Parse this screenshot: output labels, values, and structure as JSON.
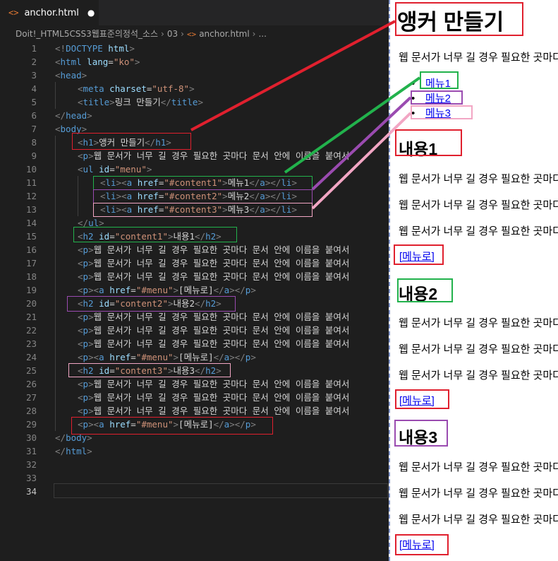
{
  "editor": {
    "tab": {
      "name": "anchor.html",
      "modified_dot": "●"
    },
    "breadcrumb": {
      "folder": "Doit!_HTML5CSS3웹표준의정석_소스",
      "subfolder": "03",
      "file": "anchor.html",
      "more": "..."
    },
    "active_line": 34,
    "lines": [
      {
        "n": "1",
        "ind": 0,
        "tok": [
          [
            "p",
            "<!"
          ],
          [
            "t",
            "DOCTYPE"
          ],
          [
            "x",
            " "
          ],
          [
            "a",
            "html"
          ],
          [
            "p",
            ">"
          ]
        ]
      },
      {
        "n": "2",
        "ind": 0,
        "tok": [
          [
            "p",
            "<"
          ],
          [
            "t",
            "html"
          ],
          [
            "x",
            " "
          ],
          [
            "a",
            "lang"
          ],
          [
            "x",
            "="
          ],
          [
            "s",
            "\"ko\""
          ],
          [
            "p",
            ">"
          ]
        ]
      },
      {
        "n": "3",
        "ind": 0,
        "tok": [
          [
            "p",
            "<"
          ],
          [
            "t",
            "head"
          ],
          [
            "p",
            ">"
          ]
        ]
      },
      {
        "n": "4",
        "ind": 1,
        "tok": [
          [
            "p",
            "<"
          ],
          [
            "t",
            "meta"
          ],
          [
            "x",
            " "
          ],
          [
            "a",
            "charset"
          ],
          [
            "x",
            "="
          ],
          [
            "s",
            "\"utf-8\""
          ],
          [
            "p",
            ">"
          ]
        ]
      },
      {
        "n": "5",
        "ind": 1,
        "tok": [
          [
            "p",
            "<"
          ],
          [
            "t",
            "title"
          ],
          [
            "p",
            ">"
          ],
          [
            "x",
            "링크 만들기"
          ],
          [
            "p",
            "</"
          ],
          [
            "t",
            "title"
          ],
          [
            "p",
            ">"
          ]
        ]
      },
      {
        "n": "6",
        "ind": 0,
        "tok": [
          [
            "p",
            "</"
          ],
          [
            "t",
            "head"
          ],
          [
            "p",
            ">"
          ]
        ]
      },
      {
        "n": "7",
        "ind": 0,
        "tok": [
          [
            "p",
            "<"
          ],
          [
            "t",
            "body"
          ],
          [
            "p",
            ">"
          ]
        ]
      },
      {
        "n": "8",
        "ind": 1,
        "tok": [
          [
            "p",
            "<"
          ],
          [
            "t",
            "h1"
          ],
          [
            "p",
            ">"
          ],
          [
            "x",
            "앵커 만들기"
          ],
          [
            "p",
            "</"
          ],
          [
            "t",
            "h1"
          ],
          [
            "p",
            ">"
          ]
        ]
      },
      {
        "n": "9",
        "ind": 1,
        "tok": [
          [
            "p",
            "<"
          ],
          [
            "t",
            "p"
          ],
          [
            "p",
            ">"
          ],
          [
            "x",
            "웹 문서가 너무 길 경우 필요한 곳마다 문서 안에 이름을 붙여서"
          ]
        ]
      },
      {
        "n": "10",
        "ind": 1,
        "tok": [
          [
            "p",
            "<"
          ],
          [
            "t",
            "ul"
          ],
          [
            "x",
            " "
          ],
          [
            "a",
            "id"
          ],
          [
            "x",
            "="
          ],
          [
            "s",
            "\"menu\""
          ],
          [
            "p",
            ">"
          ]
        ]
      },
      {
        "n": "11",
        "ind": 2,
        "tok": [
          [
            "p",
            "<"
          ],
          [
            "t",
            "li"
          ],
          [
            "p",
            "><"
          ],
          [
            "t",
            "a"
          ],
          [
            "x",
            " "
          ],
          [
            "a",
            "href"
          ],
          [
            "x",
            "="
          ],
          [
            "s",
            "\"#content1\""
          ],
          [
            "p",
            ">"
          ],
          [
            "x",
            "메뉴1"
          ],
          [
            "p",
            "</"
          ],
          [
            "t",
            "a"
          ],
          [
            "p",
            "></"
          ],
          [
            "t",
            "li"
          ],
          [
            "p",
            ">"
          ]
        ]
      },
      {
        "n": "12",
        "ind": 2,
        "tok": [
          [
            "p",
            "<"
          ],
          [
            "t",
            "li"
          ],
          [
            "p",
            "><"
          ],
          [
            "t",
            "a"
          ],
          [
            "x",
            " "
          ],
          [
            "a",
            "href"
          ],
          [
            "x",
            "="
          ],
          [
            "s",
            "\"#content2\""
          ],
          [
            "p",
            ">"
          ],
          [
            "x",
            "메뉴2"
          ],
          [
            "p",
            "</"
          ],
          [
            "t",
            "a"
          ],
          [
            "p",
            "></"
          ],
          [
            "t",
            "li"
          ],
          [
            "p",
            ">"
          ]
        ]
      },
      {
        "n": "13",
        "ind": 2,
        "tok": [
          [
            "p",
            "<"
          ],
          [
            "t",
            "li"
          ],
          [
            "p",
            "><"
          ],
          [
            "t",
            "a"
          ],
          [
            "x",
            " "
          ],
          [
            "a",
            "href"
          ],
          [
            "x",
            "="
          ],
          [
            "s",
            "\"#content3\""
          ],
          [
            "p",
            ">"
          ],
          [
            "x",
            "메뉴3"
          ],
          [
            "p",
            "</"
          ],
          [
            "t",
            "a"
          ],
          [
            "p",
            "></"
          ],
          [
            "t",
            "li"
          ],
          [
            "p",
            ">"
          ]
        ]
      },
      {
        "n": "14",
        "ind": 1,
        "tok": [
          [
            "p",
            "</"
          ],
          [
            "t",
            "ul"
          ],
          [
            "p",
            ">"
          ]
        ]
      },
      {
        "n": "15",
        "ind": 1,
        "tok": [
          [
            "p",
            "<"
          ],
          [
            "t",
            "h2"
          ],
          [
            "x",
            " "
          ],
          [
            "a",
            "id"
          ],
          [
            "x",
            "="
          ],
          [
            "s",
            "\"content1\""
          ],
          [
            "p",
            ">"
          ],
          [
            "x",
            "내용1"
          ],
          [
            "p",
            "</"
          ],
          [
            "t",
            "h2"
          ],
          [
            "p",
            ">"
          ]
        ]
      },
      {
        "n": "16",
        "ind": 1,
        "tok": [
          [
            "p",
            "<"
          ],
          [
            "t",
            "p"
          ],
          [
            "p",
            ">"
          ],
          [
            "x",
            "웹 문서가 너무 길 경우 필요한 곳마다 문서 안에 이름을 붙여서"
          ]
        ]
      },
      {
        "n": "17",
        "ind": 1,
        "tok": [
          [
            "p",
            "<"
          ],
          [
            "t",
            "p"
          ],
          [
            "p",
            ">"
          ],
          [
            "x",
            "웹 문서가 너무 길 경우 필요한 곳마다 문서 안에 이름을 붙여서"
          ]
        ]
      },
      {
        "n": "18",
        "ind": 1,
        "tok": [
          [
            "p",
            "<"
          ],
          [
            "t",
            "p"
          ],
          [
            "p",
            ">"
          ],
          [
            "x",
            "웹 문서가 너무 길 경우 필요한 곳마다 문서 안에 이름을 붙여서"
          ]
        ]
      },
      {
        "n": "19",
        "ind": 1,
        "tok": [
          [
            "p",
            "<"
          ],
          [
            "t",
            "p"
          ],
          [
            "p",
            "><"
          ],
          [
            "t",
            "a"
          ],
          [
            "x",
            " "
          ],
          [
            "a",
            "href"
          ],
          [
            "x",
            "="
          ],
          [
            "s",
            "\"#menu\""
          ],
          [
            "p",
            ">"
          ],
          [
            "x",
            "[메뉴로]"
          ],
          [
            "p",
            "</"
          ],
          [
            "t",
            "a"
          ],
          [
            "p",
            "></"
          ],
          [
            "t",
            "p"
          ],
          [
            "p",
            ">"
          ]
        ]
      },
      {
        "n": "20",
        "ind": 1,
        "tok": [
          [
            "p",
            "<"
          ],
          [
            "t",
            "h2"
          ],
          [
            "x",
            " "
          ],
          [
            "a",
            "id"
          ],
          [
            "x",
            "="
          ],
          [
            "s",
            "\"content2\""
          ],
          [
            "p",
            ">"
          ],
          [
            "x",
            "내용2"
          ],
          [
            "p",
            "</"
          ],
          [
            "t",
            "h2"
          ],
          [
            "p",
            ">"
          ]
        ]
      },
      {
        "n": "21",
        "ind": 1,
        "tok": [
          [
            "p",
            "<"
          ],
          [
            "t",
            "p"
          ],
          [
            "p",
            ">"
          ],
          [
            "x",
            "웹 문서가 너무 길 경우 필요한 곳마다 문서 안에 이름을 붙여서"
          ]
        ]
      },
      {
        "n": "22",
        "ind": 1,
        "tok": [
          [
            "p",
            "<"
          ],
          [
            "t",
            "p"
          ],
          [
            "p",
            ">"
          ],
          [
            "x",
            "웹 문서가 너무 길 경우 필요한 곳마다 문서 안에 이름을 붙여서"
          ]
        ]
      },
      {
        "n": "23",
        "ind": 1,
        "tok": [
          [
            "p",
            "<"
          ],
          [
            "t",
            "p"
          ],
          [
            "p",
            ">"
          ],
          [
            "x",
            "웹 문서가 너무 길 경우 필요한 곳마다 문서 안에 이름을 붙여서"
          ]
        ]
      },
      {
        "n": "24",
        "ind": 1,
        "tok": [
          [
            "p",
            "<"
          ],
          [
            "t",
            "p"
          ],
          [
            "p",
            "><"
          ],
          [
            "t",
            "a"
          ],
          [
            "x",
            " "
          ],
          [
            "a",
            "href"
          ],
          [
            "x",
            "="
          ],
          [
            "s",
            "\"#menu\""
          ],
          [
            "p",
            ">"
          ],
          [
            "x",
            "[메뉴로]"
          ],
          [
            "p",
            "</"
          ],
          [
            "t",
            "a"
          ],
          [
            "p",
            "></"
          ],
          [
            "t",
            "p"
          ],
          [
            "p",
            ">"
          ]
        ]
      },
      {
        "n": "25",
        "ind": 1,
        "tok": [
          [
            "p",
            "<"
          ],
          [
            "t",
            "h2"
          ],
          [
            "x",
            " "
          ],
          [
            "a",
            "id"
          ],
          [
            "x",
            "="
          ],
          [
            "s",
            "\"content3\""
          ],
          [
            "p",
            ">"
          ],
          [
            "x",
            "내용3"
          ],
          [
            "p",
            "</"
          ],
          [
            "t",
            "h2"
          ],
          [
            "p",
            ">"
          ]
        ]
      },
      {
        "n": "26",
        "ind": 1,
        "tok": [
          [
            "p",
            "<"
          ],
          [
            "t",
            "p"
          ],
          [
            "p",
            ">"
          ],
          [
            "x",
            "웹 문서가 너무 길 경우 필요한 곳마다 문서 안에 이름을 붙여서"
          ]
        ]
      },
      {
        "n": "27",
        "ind": 1,
        "tok": [
          [
            "p",
            "<"
          ],
          [
            "t",
            "p"
          ],
          [
            "p",
            ">"
          ],
          [
            "x",
            "웹 문서가 너무 길 경우 필요한 곳마다 문서 안에 이름을 붙여서"
          ]
        ]
      },
      {
        "n": "28",
        "ind": 1,
        "tok": [
          [
            "p",
            "<"
          ],
          [
            "t",
            "p"
          ],
          [
            "p",
            ">"
          ],
          [
            "x",
            "웹 문서가 너무 길 경우 필요한 곳마다 문서 안에 이름을 붙여서"
          ]
        ]
      },
      {
        "n": "29",
        "ind": 1,
        "tok": [
          [
            "p",
            "<"
          ],
          [
            "t",
            "p"
          ],
          [
            "p",
            "><"
          ],
          [
            "t",
            "a"
          ],
          [
            "x",
            " "
          ],
          [
            "a",
            "href"
          ],
          [
            "x",
            "="
          ],
          [
            "s",
            "\"#menu\""
          ],
          [
            "p",
            ">"
          ],
          [
            "x",
            "[메뉴로]"
          ],
          [
            "p",
            "</"
          ],
          [
            "t",
            "a"
          ],
          [
            "p",
            "></"
          ],
          [
            "t",
            "p"
          ],
          [
            "p",
            ">"
          ]
        ]
      },
      {
        "n": "30",
        "ind": 0,
        "tok": [
          [
            "p",
            "</"
          ],
          [
            "t",
            "body"
          ],
          [
            "p",
            ">"
          ]
        ]
      },
      {
        "n": "31",
        "ind": 0,
        "tok": [
          [
            "p",
            "</"
          ],
          [
            "t",
            "html"
          ],
          [
            "p",
            ">"
          ]
        ]
      },
      {
        "n": "32",
        "ind": 0,
        "tok": []
      },
      {
        "n": "33",
        "ind": 0,
        "tok": []
      },
      {
        "n": "34",
        "ind": 0,
        "tok": []
      }
    ]
  },
  "preview": {
    "h1": "앵커 만들기",
    "paragraph": "웹 문서가 너무 길 경우 필요한 곳마다 문서 안에 이름을 붙여서",
    "menu": [
      "메뉴1",
      "메뉴2",
      "메뉴3"
    ],
    "sections": [
      {
        "title": "내용1",
        "back_link": "[메뉴로]"
      },
      {
        "title": "내용2",
        "back_link": "[메뉴로]"
      },
      {
        "title": "내용3",
        "back_link": "[메뉴로]"
      }
    ]
  },
  "colors": {
    "h1": "#e0202e",
    "menu1": "#22b24c",
    "menu2": "#9a4bb0",
    "menu3": "#f2a6c4",
    "content1": "#e0202e",
    "content2": "#22b24c",
    "content3": "#9a4bb0",
    "back_link": "#e0202e"
  }
}
